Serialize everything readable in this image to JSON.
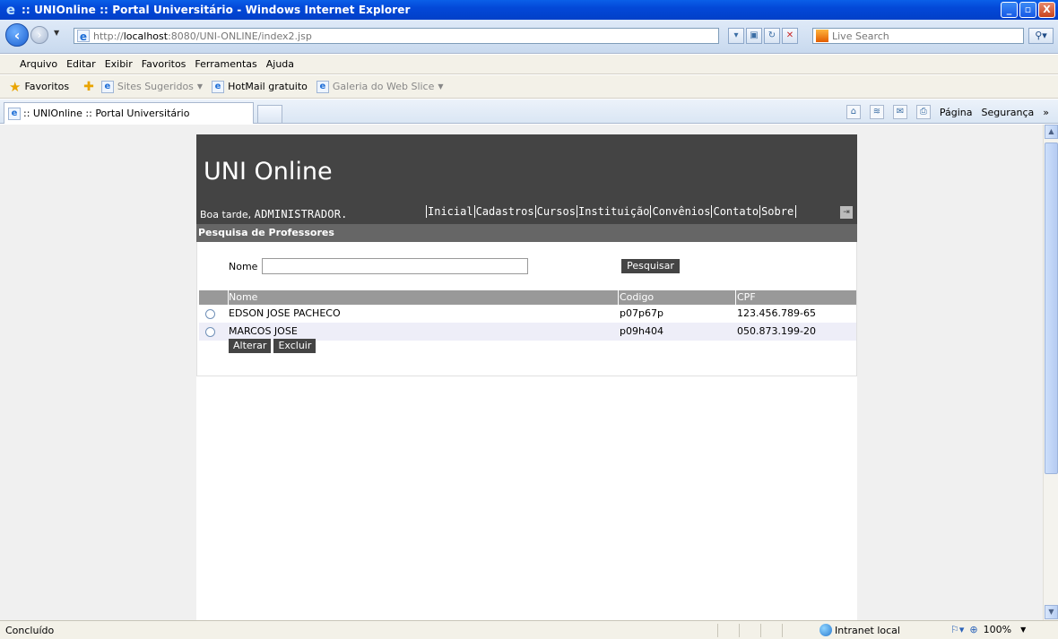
{
  "window": {
    "title": ":: UNIOnline :: Portal Universitário - Windows Internet Explorer",
    "buttons": {
      "minimize": "_",
      "maximize": "▫",
      "close": "X"
    }
  },
  "address": {
    "url_prefix": "http://",
    "url_host": "localhost",
    "url_rest": ":8080/UNI-ONLINE/index2.jsp",
    "search_placeholder": "Live Search"
  },
  "menu": [
    "Arquivo",
    "Editar",
    "Exibir",
    "Favoritos",
    "Ferramentas",
    "Ajuda"
  ],
  "favorites_bar": {
    "label": "Favoritos",
    "items": [
      "Sites Sugeridos",
      "HotMail gratuito",
      "Galeria do Web Slice"
    ]
  },
  "tab": {
    "title": ":: UNIOnline :: Portal Universitário"
  },
  "commandbar": {
    "page": "Página",
    "security": "Segurança",
    "more": "»"
  },
  "site": {
    "title": "UNI Online",
    "greeting_prefix": "Boa tarde, ",
    "user": "ADMINISTRADOR.",
    "nav": [
      "Inicial",
      "Cadastros",
      "Cursos",
      "Instituição",
      "Convênios",
      "Contato",
      "Sobre"
    ]
  },
  "section": {
    "title": "Pesquisa de Professores"
  },
  "search_form": {
    "label": "Nome",
    "value": "",
    "button": "Pesquisar"
  },
  "table": {
    "headers": {
      "nome": "Nome",
      "codigo": "Codigo",
      "cpf": "CPF"
    },
    "rows": [
      {
        "nome": "EDSON JOSE PACHECO",
        "codigo": "p07p67p",
        "cpf": "123.456.789-65"
      },
      {
        "nome": "MARCOS JOSE",
        "codigo": "p09h404",
        "cpf": "050.873.199-20"
      }
    ]
  },
  "actions": {
    "alterar": "Alterar",
    "excluir": "Excluir"
  },
  "status": {
    "text": "Concluído",
    "zone": "Intranet local",
    "zoom": "100%"
  }
}
